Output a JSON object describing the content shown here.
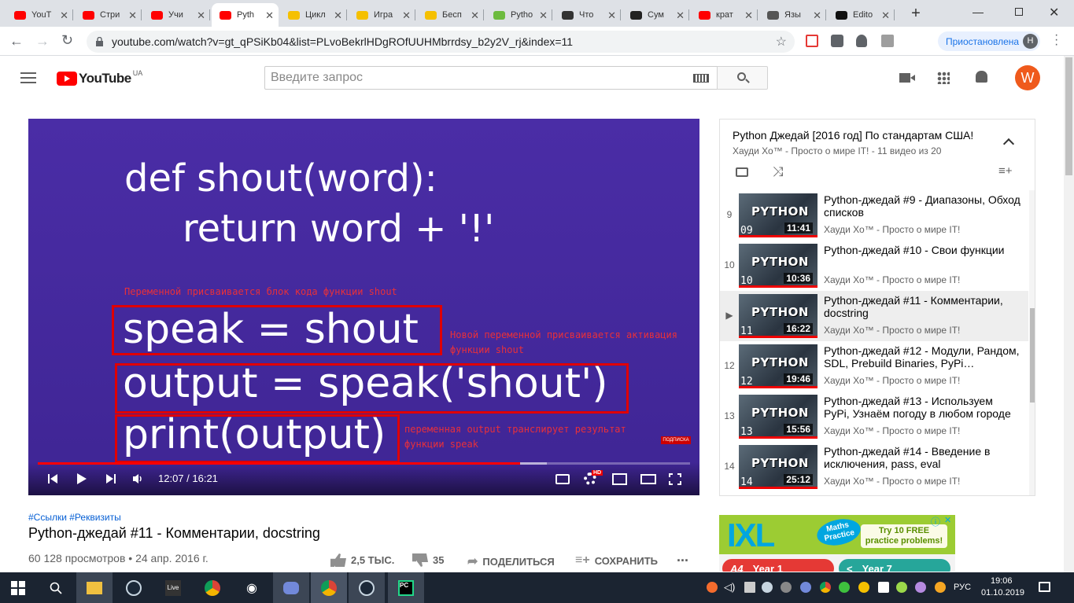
{
  "browser": {
    "tabs": [
      {
        "label": "YouT",
        "color": "#ff0000",
        "active": false
      },
      {
        "label": "Стри",
        "color": "#ff0000",
        "active": false
      },
      {
        "label": "Учи",
        "color": "#ff0000",
        "active": false
      },
      {
        "label": "Pyth",
        "color": "#ff0000",
        "active": true
      },
      {
        "label": "Цикл",
        "color": "#f5c000",
        "active": false
      },
      {
        "label": "Игра",
        "color": "#f5c000",
        "active": false
      },
      {
        "label": "Бесп",
        "color": "#f5c000",
        "active": false
      },
      {
        "label": "Pytho",
        "color": "#6dbb3f",
        "active": false
      },
      {
        "label": "Что",
        "color": "#333333",
        "active": false
      },
      {
        "label": "Сум",
        "color": "#222222",
        "active": false
      },
      {
        "label": "крат",
        "color": "#ff0000",
        "active": false
      },
      {
        "label": "Язы",
        "color": "#555555",
        "active": false
      },
      {
        "label": "Edito",
        "color": "#111111",
        "active": false
      }
    ],
    "url": "youtube.com/watch?v=gt_qPSiKb04&list=PLvoBekrlHDgROfUUHMbrrdsy_b2y2V_rj&index=11",
    "profile_status": "Приостановлена",
    "profile_initial": "H"
  },
  "youtube": {
    "logo_text": "YouTube",
    "region": "UA",
    "search_placeholder": "Введите запрос",
    "avatar_initial": "W",
    "accent": "#ff0000"
  },
  "video": {
    "slide": {
      "line1": "def shout(word):",
      "line2": "return word + '!'",
      "note1": "Переменной присваивается блок кода функции shout",
      "line3": "speak = shout",
      "note2": "Новой переменной присваивается активация функции shout",
      "line4": "output = speak('shout')",
      "line5": "print(output)",
      "note3": "переменная output транслирует результат функции speak",
      "subscribe_badge": "ПОДПИСКА"
    },
    "time": "12:07 / 16:21",
    "progress": 0.74,
    "buffered": 0.78,
    "hd_badge": "HD",
    "hashtags": "#Ссылки #Реквизиты",
    "title": "Python-джедай #11 - Комментарии, docstring",
    "views": "60 128 просмотров • 24 апр. 2016 г.",
    "likes": "2,5 ТЫС.",
    "dislikes": "35",
    "share_label": "ПОДЕЛИТЬСЯ",
    "save_label": "СОХРАНИТЬ",
    "more": "..."
  },
  "playlist": {
    "title": "Python Джедай [2016 год] По стандартам США!",
    "subtitle": "Хауди Хо™ - Просто о мире IT! - 11 видео из 20",
    "items": [
      {
        "num": "9",
        "title": "Python-джедай #9 - Диапазоны, Обход списков",
        "channel": "Хауди Хо™ - Просто о мире IT!",
        "duration": "11:41",
        "ep": "09",
        "thumb_text": "PYTHON"
      },
      {
        "num": "10",
        "title": "Python-джедай #10 - Свои функции",
        "channel": "Хауди Хо™ - Просто о мире IT!",
        "duration": "10:36",
        "ep": "10",
        "thumb_text": "PYTHON"
      },
      {
        "num": "▶",
        "title": "Python-джедай #11 - Комментарии, docstring",
        "channel": "Хауди Хо™ - Просто о мире IT!",
        "duration": "16:22",
        "ep": "11",
        "thumb_text": "PYTHON"
      },
      {
        "num": "12",
        "title": "Python-джедай #12 - Модули, Рандом, SDL, Prebuild Binaries, PyPi…",
        "channel": "Хауди Хо™ - Просто о мире IT!",
        "duration": "19:46",
        "ep": "12",
        "thumb_text": "PYTHON"
      },
      {
        "num": "13",
        "title": "Python-джедай #13 - Используем PyPi, Узнаём погоду в любом городе",
        "channel": "Хауди Хо™ - Просто о мире IT!",
        "duration": "15:56",
        "ep": "13",
        "thumb_text": "PYTHON"
      },
      {
        "num": "14",
        "title": "Python-джедай #14 - Введение в исключения, pass, eval",
        "channel": "Хауди Хо™ - Просто о мире IT!",
        "duration": "25:12",
        "ep": "14",
        "thumb_text": "PYTHON"
      }
    ]
  },
  "ad": {
    "brand": "IXL",
    "badge": "Maths Practice",
    "cta": "Try 10 FREE practice problems!",
    "btn1": "Year 1",
    "btn2": "Year 7",
    "grade1": "A4",
    "info_icon": "ⓘ",
    "close": "✕"
  },
  "taskbar": {
    "lang": "РУС",
    "time": "19:06",
    "date": "01.10.2019"
  }
}
